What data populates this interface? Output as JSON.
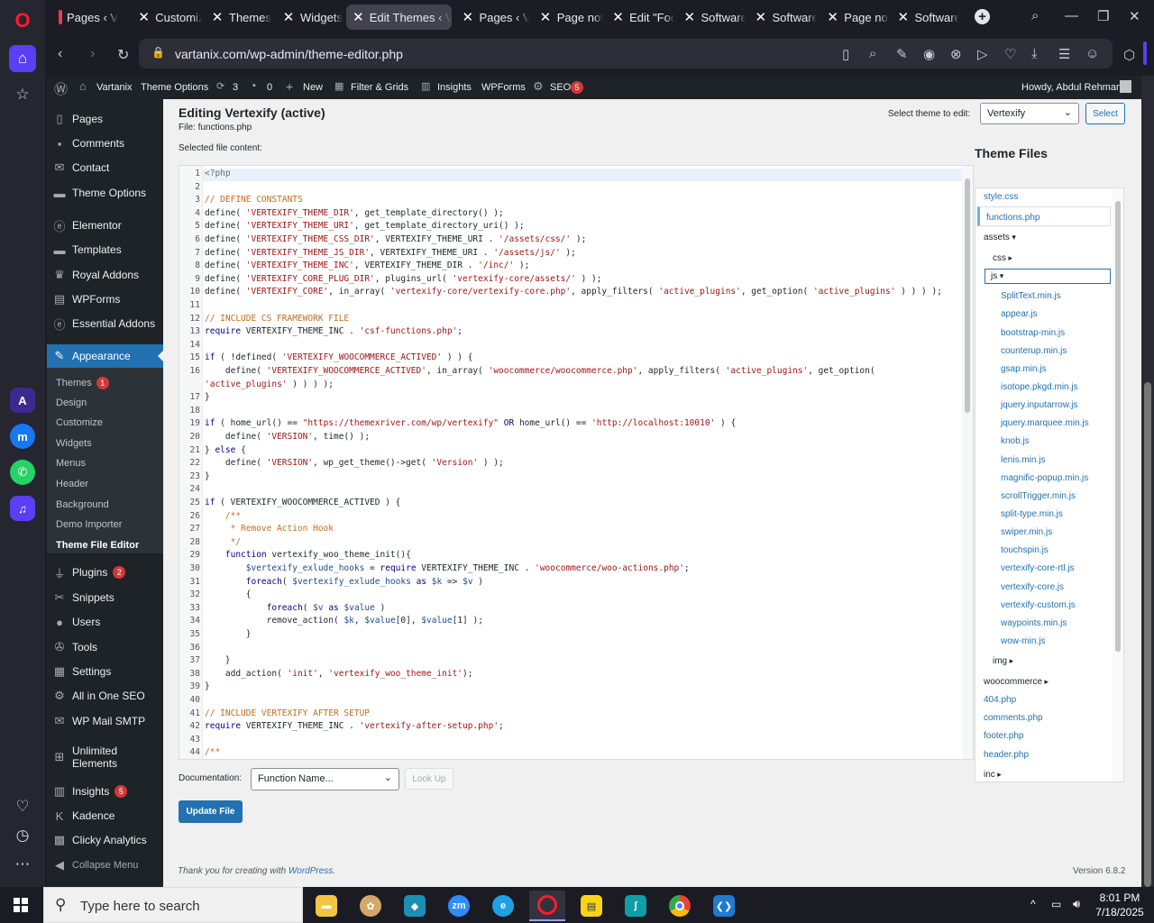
{
  "browser": {
    "tabs": [
      {
        "label": "Pages ‹ V",
        "active": false
      },
      {
        "label": "Customiz",
        "active": false
      },
      {
        "label": "Themes",
        "active": false
      },
      {
        "label": "Widgets",
        "active": false
      },
      {
        "label": "Edit Themes ‹ Va",
        "active": true
      },
      {
        "label": "Pages ‹ V",
        "active": false
      },
      {
        "label": "Page not",
        "active": false
      },
      {
        "label": "Edit \"Foo",
        "active": false
      },
      {
        "label": "Software",
        "active": false
      },
      {
        "label": "Software",
        "active": false
      },
      {
        "label": "Page not",
        "active": false
      },
      {
        "label": "Software",
        "active": false
      }
    ],
    "url": "vartanix.com/wp-admin/theme-editor.php"
  },
  "adminbar": {
    "site": "Vartanix",
    "theme_options": "Theme Options",
    "updates": "3",
    "comments": "0",
    "new": "New",
    "filter_grids": "Filter & Grids",
    "insights": "Insights",
    "wpforms": "WPForms",
    "seo": "SEO",
    "seo_count": "5",
    "howdy": "Howdy, Abdul Rehman"
  },
  "menu": {
    "items": [
      {
        "label": "Pages",
        "icon": "pages-icon"
      },
      {
        "label": "Comments",
        "icon": "comments-icon"
      },
      {
        "label": "Contact",
        "icon": "contact-icon"
      },
      {
        "label": "Theme Options",
        "icon": "folder-icon"
      },
      {
        "label": "Elementor",
        "icon": "elementor-icon"
      },
      {
        "label": "Templates",
        "icon": "folder-icon"
      },
      {
        "label": "Royal Addons",
        "icon": "crown-icon"
      },
      {
        "label": "WPForms",
        "icon": "form-icon"
      },
      {
        "label": "Essential Addons",
        "icon": "ea-icon"
      },
      {
        "label": "Appearance",
        "icon": "brush-icon"
      },
      {
        "label": "Plugins",
        "icon": "plug-icon",
        "badge": "2"
      },
      {
        "label": "Snippets",
        "icon": "scissors-icon"
      },
      {
        "label": "Users",
        "icon": "user-icon"
      },
      {
        "label": "Tools",
        "icon": "wrench-icon"
      },
      {
        "label": "Settings",
        "icon": "settings-icon"
      },
      {
        "label": "All in One SEO",
        "icon": "seo-icon"
      },
      {
        "label": "WP Mail SMTP",
        "icon": "mail-icon"
      },
      {
        "label": "Unlimited Elements",
        "icon": "ue-icon"
      },
      {
        "label": "Insights",
        "icon": "insights-icon",
        "badge": "5"
      },
      {
        "label": "Kadence",
        "icon": "kadence-icon"
      },
      {
        "label": "Clicky Analytics",
        "icon": "chart-icon"
      },
      {
        "label": "Collapse Menu",
        "icon": "collapse-icon"
      }
    ],
    "appearance_sub": [
      {
        "label": "Themes",
        "badge": "1"
      },
      {
        "label": "Design"
      },
      {
        "label": "Customize"
      },
      {
        "label": "Widgets"
      },
      {
        "label": "Menus"
      },
      {
        "label": "Header"
      },
      {
        "label": "Background"
      },
      {
        "label": "Demo Importer"
      },
      {
        "label": "Theme File Editor"
      }
    ]
  },
  "editor": {
    "title": "Editing Vertexify (active)",
    "file_label": "File: functions.php",
    "selected_content_label": "Selected file content:",
    "select_theme_label": "Select theme to edit:",
    "theme_value": "Vertexify",
    "select_button": "Select",
    "theme_files_title": "Theme Files",
    "documentation_label": "Documentation:",
    "doc_placeholder": "Function Name...",
    "lookup_button": "Look Up",
    "update_button": "Update File",
    "footer_thanks": "Thank you for creating with",
    "footer_wp": "WordPress",
    "version": "Version 6.8.2"
  },
  "code_lines": [
    "<?php",
    "",
    "// DEFINE CONSTANTS",
    "define( 'VERTEXIFY_THEME_DIR', get_template_directory() );",
    "define( 'VERTEXIFY_THEME_URI', get_template_directory_uri() );",
    "define( 'VERTEXIFY_THEME_CSS_DIR', VERTEXIFY_THEME_URI . '/assets/css/' );",
    "define( 'VERTEXIFY_THEME_JS_DIR', VERTEXIFY_THEME_URI . '/assets/js/' );",
    "define( 'VERTEXIFY_THEME_INC', VERTEXIFY_THEME_DIR . '/inc/' );",
    "define( 'VERTEXIFY_CORE_PLUG_DIR', plugins_url( 'vertexify-core/assets/' ) );",
    "define( 'VERTEXIFY_CORE', in_array( 'vertexify-core/vertexify-core.php', apply_filters( 'active_plugins', get_option( 'active_plugins' ) ) ) );",
    "",
    "// INCLUDE CS FRAMEWORK FILE",
    "require VERTEXIFY_THEME_INC . 'csf-functions.php';",
    "",
    "if ( !defined( 'VERTEXIFY_WOOCOMMERCE_ACTIVED' ) ) {",
    "    define( 'VERTEXIFY_WOOCOMMERCE_ACTIVED', in_array( 'woocommerce/woocommerce.php', apply_filters( 'active_plugins', get_option(",
    "'active_plugins' ) ) ) );",
    "}",
    "",
    "if ( home_url() == \"https://themexriver.com/wp/vertexify\" OR home_url() == 'http://localhost:10010' ) {",
    "    define( 'VERSION', time() );",
    "} else {",
    "    define( 'VERSION', wp_get_theme()->get( 'Version' ) );",
    "}",
    "",
    "if ( VERTEXIFY_WOOCOMMERCE_ACTIVED ) {",
    "    /**",
    "     * Remove Action Hook",
    "     */",
    "    function vertexify_woo_theme_init(){",
    "        $vertexify_exlude_hooks = require VERTEXIFY_THEME_INC . 'woocommerce/woo-actions.php';",
    "        foreach( $vertexify_exlude_hooks as $k => $v )",
    "        {",
    "            foreach( $v as $value )",
    "            remove_action( $k, $value[0], $value[1] );",
    "        }",
    "",
    "    }",
    "    add_action( 'init', 'vertexify_woo_theme_init');",
    "}",
    "",
    "// INCLUDE VERTEXIFY AFTER SETUP",
    "require VERTEXIFY_THEME_INC . 'vertexify-after-setup.php';",
    "",
    "/**"
  ],
  "line_numbers": [
    "1",
    "2",
    "3",
    "4",
    "5",
    "6",
    "7",
    "8",
    "9",
    "10",
    "11",
    "12",
    "13",
    "14",
    "15",
    "16",
    "",
    "17",
    "18",
    "19",
    "20",
    "21",
    "22",
    "23",
    "24",
    "25",
    "26",
    "27",
    "28",
    "29",
    "30",
    "31",
    "32",
    "33",
    "34",
    "35",
    "36",
    "37",
    "38",
    "39",
    "40",
    "41",
    "42",
    "43",
    "44"
  ],
  "files": [
    {
      "name": "style.css",
      "kind": "file",
      "level": 0
    },
    {
      "name": "functions.php",
      "kind": "file",
      "level": 0,
      "selected": true
    },
    {
      "name": "assets",
      "kind": "dir",
      "level": 0
    },
    {
      "name": "css",
      "kind": "dir",
      "level": 1
    },
    {
      "name": "js",
      "kind": "dir",
      "level": 1,
      "focused": true
    },
    {
      "name": "SplitText.min.js",
      "kind": "file",
      "level": 2
    },
    {
      "name": "appear.js",
      "kind": "file",
      "level": 2
    },
    {
      "name": "bootstrap-min.js",
      "kind": "file",
      "level": 2
    },
    {
      "name": "counterup.min.js",
      "kind": "file",
      "level": 2
    },
    {
      "name": "gsap.min.js",
      "kind": "file",
      "level": 2
    },
    {
      "name": "isotope.pkgd.min.js",
      "kind": "file",
      "level": 2
    },
    {
      "name": "jquery.inputarrow.js",
      "kind": "file",
      "level": 2
    },
    {
      "name": "jquery.marquee.min.js",
      "kind": "file",
      "level": 2
    },
    {
      "name": "knob.js",
      "kind": "file",
      "level": 2
    },
    {
      "name": "lenis.min.js",
      "kind": "file",
      "level": 2
    },
    {
      "name": "magnific-popup.min.js",
      "kind": "file",
      "level": 2
    },
    {
      "name": "scrollTrigger.min.js",
      "kind": "file",
      "level": 2
    },
    {
      "name": "split-type.min.js",
      "kind": "file",
      "level": 2
    },
    {
      "name": "swiper.min.js",
      "kind": "file",
      "level": 2
    },
    {
      "name": "touchspin.js",
      "kind": "file",
      "level": 2
    },
    {
      "name": "vertexify-core-rtl.js",
      "kind": "file",
      "level": 2
    },
    {
      "name": "vertexify-core.js",
      "kind": "file",
      "level": 2
    },
    {
      "name": "vertexify-custom.js",
      "kind": "file",
      "level": 2
    },
    {
      "name": "waypoints.min.js",
      "kind": "file",
      "level": 2
    },
    {
      "name": "wow-min.js",
      "kind": "file",
      "level": 2
    },
    {
      "name": "img",
      "kind": "dir",
      "level": 1
    },
    {
      "name": "woocommerce",
      "kind": "dir",
      "level": 0
    },
    {
      "name": "404.php",
      "kind": "file",
      "level": 0
    },
    {
      "name": "comments.php",
      "kind": "file",
      "level": 0
    },
    {
      "name": "footer.php",
      "kind": "file",
      "level": 0
    },
    {
      "name": "header.php",
      "kind": "file",
      "level": 0
    },
    {
      "name": "inc",
      "kind": "dir",
      "level": 0
    }
  ],
  "taskbar": {
    "search_placeholder": "Type here to search",
    "time": "8:01 PM",
    "date": "7/18/2025"
  }
}
